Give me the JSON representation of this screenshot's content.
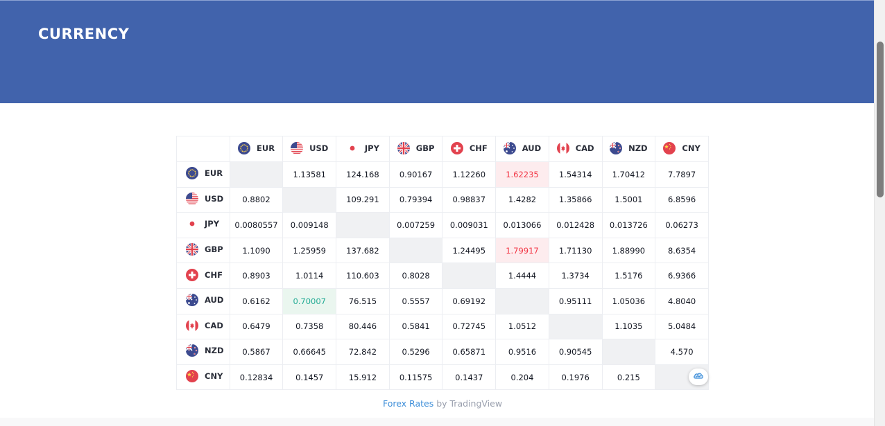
{
  "header": {
    "title": "CURRENCY"
  },
  "currencies": [
    {
      "code": "EUR",
      "flag": "eu-flag-icon"
    },
    {
      "code": "USD",
      "flag": "us-flag-icon"
    },
    {
      "code": "JPY",
      "flag": "jp-flag-icon"
    },
    {
      "code": "GBP",
      "flag": "gb-flag-icon"
    },
    {
      "code": "CHF",
      "flag": "ch-flag-icon"
    },
    {
      "code": "AUD",
      "flag": "au-flag-icon"
    },
    {
      "code": "CAD",
      "flag": "ca-flag-icon"
    },
    {
      "code": "NZD",
      "flag": "nz-flag-icon"
    },
    {
      "code": "CNY",
      "flag": "cn-flag-icon"
    }
  ],
  "rows": [
    {
      "code": "EUR",
      "cells": [
        "",
        "1.13581",
        "124.168",
        "0.90167",
        "1.12260",
        "1.62235",
        "1.54314",
        "1.70412",
        "7.7897"
      ],
      "states": [
        "diag",
        "",
        "",
        "",
        "",
        "red",
        "",
        "",
        ""
      ]
    },
    {
      "code": "USD",
      "cells": [
        "0.8802",
        "",
        "109.291",
        "0.79394",
        "0.98837",
        "1.4282",
        "1.35866",
        "1.5001",
        "6.8596"
      ],
      "states": [
        "",
        "diag",
        "",
        "",
        "",
        "",
        "",
        "",
        ""
      ]
    },
    {
      "code": "JPY",
      "cells": [
        "0.0080557",
        "0.009148",
        "",
        "0.007259",
        "0.009031",
        "0.013066",
        "0.012428",
        "0.013726",
        "0.06273"
      ],
      "states": [
        "",
        "",
        "diag",
        "",
        "",
        "",
        "",
        "",
        ""
      ]
    },
    {
      "code": "GBP",
      "cells": [
        "1.1090",
        "1.25959",
        "137.682",
        "",
        "1.24495",
        "1.79917",
        "1.71130",
        "1.88990",
        "8.6354"
      ],
      "states": [
        "",
        "",
        "",
        "diag",
        "",
        "red",
        "",
        "",
        ""
      ]
    },
    {
      "code": "CHF",
      "cells": [
        "0.8903",
        "1.0114",
        "110.603",
        "0.8028",
        "",
        "1.4444",
        "1.3734",
        "1.5176",
        "6.9366"
      ],
      "states": [
        "",
        "",
        "",
        "",
        "diag",
        "",
        "",
        "",
        ""
      ]
    },
    {
      "code": "AUD",
      "cells": [
        "0.6162",
        "0.70007",
        "76.515",
        "0.5557",
        "0.69192",
        "",
        "0.95111",
        "1.05036",
        "4.8040"
      ],
      "states": [
        "",
        "green",
        "",
        "",
        "",
        "diag",
        "",
        "",
        ""
      ]
    },
    {
      "code": "CAD",
      "cells": [
        "0.6479",
        "0.7358",
        "80.446",
        "0.5841",
        "0.72745",
        "1.0512",
        "",
        "1.1035",
        "5.0484"
      ],
      "states": [
        "",
        "",
        "",
        "",
        "",
        "",
        "diag",
        "",
        ""
      ]
    },
    {
      "code": "NZD",
      "cells": [
        "0.5867",
        "0.66645",
        "72.842",
        "0.5296",
        "0.65871",
        "0.9516",
        "0.90545",
        "",
        "4.570"
      ],
      "states": [
        "",
        "",
        "",
        "",
        "",
        "",
        "",
        "diag",
        ""
      ]
    },
    {
      "code": "CNY",
      "cells": [
        "0.12834",
        "0.1457",
        "15.912",
        "0.11575",
        "0.1437",
        "0.204",
        "0.1976",
        "0.215",
        ""
      ],
      "states": [
        "",
        "",
        "",
        "",
        "",
        "",
        "",
        "",
        "diag"
      ]
    }
  ],
  "colors": {
    "header_bg": "#4163ac",
    "positive": "#22ab94",
    "negative": "#f23645",
    "link": "#3f8fd9"
  },
  "footer": {
    "link_text": "Forex Rates",
    "suffix": " by TradingView"
  },
  "badge_icon": "tradingview-cloud-icon"
}
